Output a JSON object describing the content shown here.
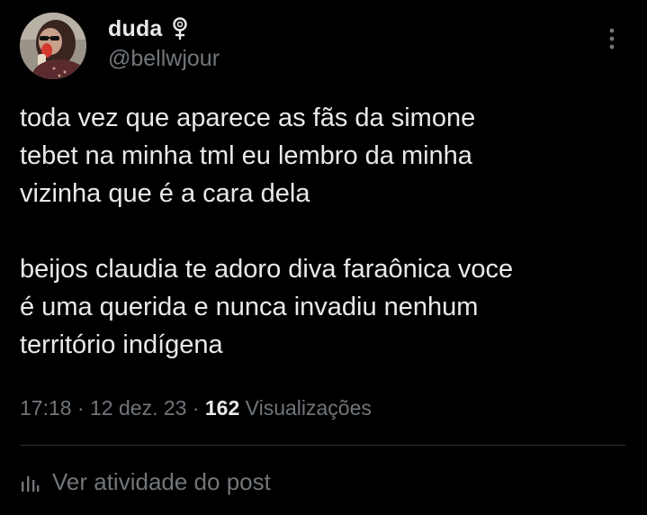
{
  "author": {
    "display_name": "duda",
    "name_emoji": "female-sign-icon",
    "handle": "@bellwjour"
  },
  "tweet": {
    "text": "toda vez que aparece as fãs da simone\ntebet na minha tml eu lembro da minha\nvizinha que é a cara dela\n\nbeijos claudia te adoro diva faraônica voce\né uma querida e nunca invadiu nenhum\nterritório indígena"
  },
  "meta": {
    "time": "17:18",
    "separator": "·",
    "date": "12 dez. 23",
    "views_count": "162",
    "views_label": "Visualizações"
  },
  "footer": {
    "activity_label": "Ver atividade do post",
    "activity_icon": "analytics-bars-icon"
  },
  "icons": {
    "more": "more-vertical-icon"
  },
  "colors": {
    "background": "#000000",
    "primary_text": "#e7e9ea",
    "secondary_text": "#71767b",
    "divider": "#2f3336"
  }
}
